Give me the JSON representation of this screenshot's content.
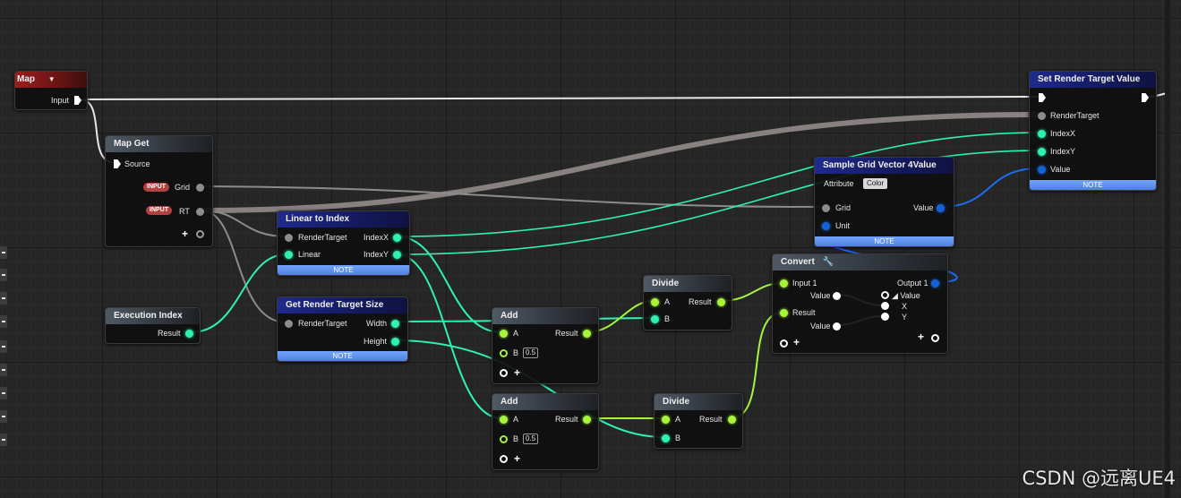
{
  "nodes": {
    "map": {
      "title": "Map",
      "input_label": "Input"
    },
    "map_get": {
      "title": "Map Get",
      "source_label": "Source",
      "grid_badge": "INPUT",
      "grid_label": "Grid",
      "rt_badge": "INPUT",
      "rt_label": "RT"
    },
    "linear_to_index": {
      "title": "Linear to Index",
      "in_rendertarget": "RenderTarget",
      "in_linear": "Linear",
      "out_indexx": "IndexX",
      "out_indexy": "IndexY",
      "note": "NOTE"
    },
    "get_rt_size": {
      "title": "Get Render Target Size",
      "in_rendertarget": "RenderTarget",
      "out_width": "Width",
      "out_height": "Height",
      "note": "NOTE"
    },
    "execution_index": {
      "title": "Execution Index",
      "out_result": "Result"
    },
    "add1": {
      "title": "Add",
      "in_a": "A",
      "in_b": "B",
      "b_value": "0.5",
      "out_result": "Result"
    },
    "add2": {
      "title": "Add",
      "in_a": "A",
      "in_b": "B",
      "b_value": "0.5",
      "out_result": "Result"
    },
    "divide1": {
      "title": "Divide",
      "in_a": "A",
      "in_b": "B",
      "out_result": "Result"
    },
    "divide2": {
      "title": "Divide",
      "in_a": "A",
      "in_b": "B",
      "out_result": "Result"
    },
    "convert": {
      "title": "Convert",
      "in_input1": "Input 1",
      "in_value_a": "Value",
      "in_result": "Result",
      "in_value_b": "Value",
      "out_output1": "Output 1",
      "out_value": "Value",
      "out_x": "X",
      "out_y": "Y"
    },
    "sample_grid": {
      "title": "Sample Grid Vector 4Value",
      "attribute_label": "Attribute",
      "attribute_value": "Color",
      "in_grid": "Grid",
      "in_unit": "Unit",
      "out_value": "Value",
      "note": "NOTE"
    },
    "set_rt_value": {
      "title": "Set Render Target Value",
      "in_rendertarget": "RenderTarget",
      "in_indexx": "IndexX",
      "in_indexy": "IndexY",
      "in_value": "Value",
      "note": "NOTE"
    }
  },
  "watermark": "CSDN @远离UE4",
  "colors": {
    "float_pin": "#2ff2b2",
    "int_pin": "#a7f53a",
    "vector4_pin": "#1462d6",
    "object_pin": "#8c8c8c",
    "exec_pin": "#ffffff",
    "note_bar": "#5b8ef0",
    "header_blue": "#1f2a8c",
    "header_red": "#9a1d1d"
  },
  "icons": {
    "map_dropdown": "triangle-down-icon",
    "convert_wrench": "wrench-icon"
  }
}
